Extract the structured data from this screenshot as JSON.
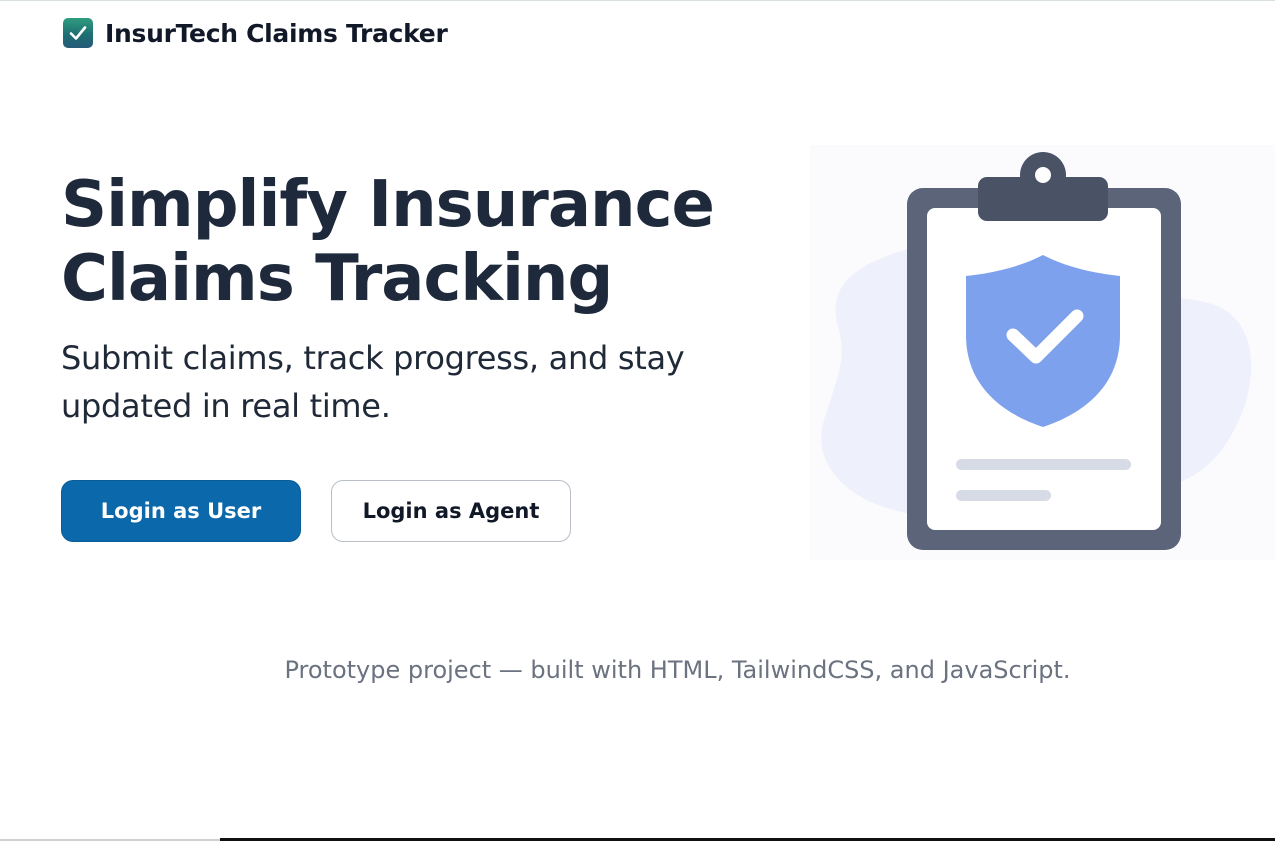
{
  "app": {
    "title": "InsurTech Claims Tracker",
    "icon": "check-mark-button-icon"
  },
  "hero": {
    "title_line1": "Simplify Insurance",
    "title_line2": "Claims Tracking",
    "subtitle": "Submit claims, track progress, and stay updated in real time."
  },
  "actions": {
    "login_user_label": "Login as User",
    "login_agent_label": "Login as Agent"
  },
  "illustration": {
    "icon": "clipboard-shield-check-icon"
  },
  "footer": {
    "note": "Prototype project — built with HTML, TailwindCSS, and JavaScript."
  },
  "colors": {
    "primary": "#0b68aa",
    "heading": "#1e293b",
    "muted": "#6b7280",
    "clipboard": "#5b6478",
    "shield": "#7ea1ee",
    "blob": "#eef0fb"
  }
}
